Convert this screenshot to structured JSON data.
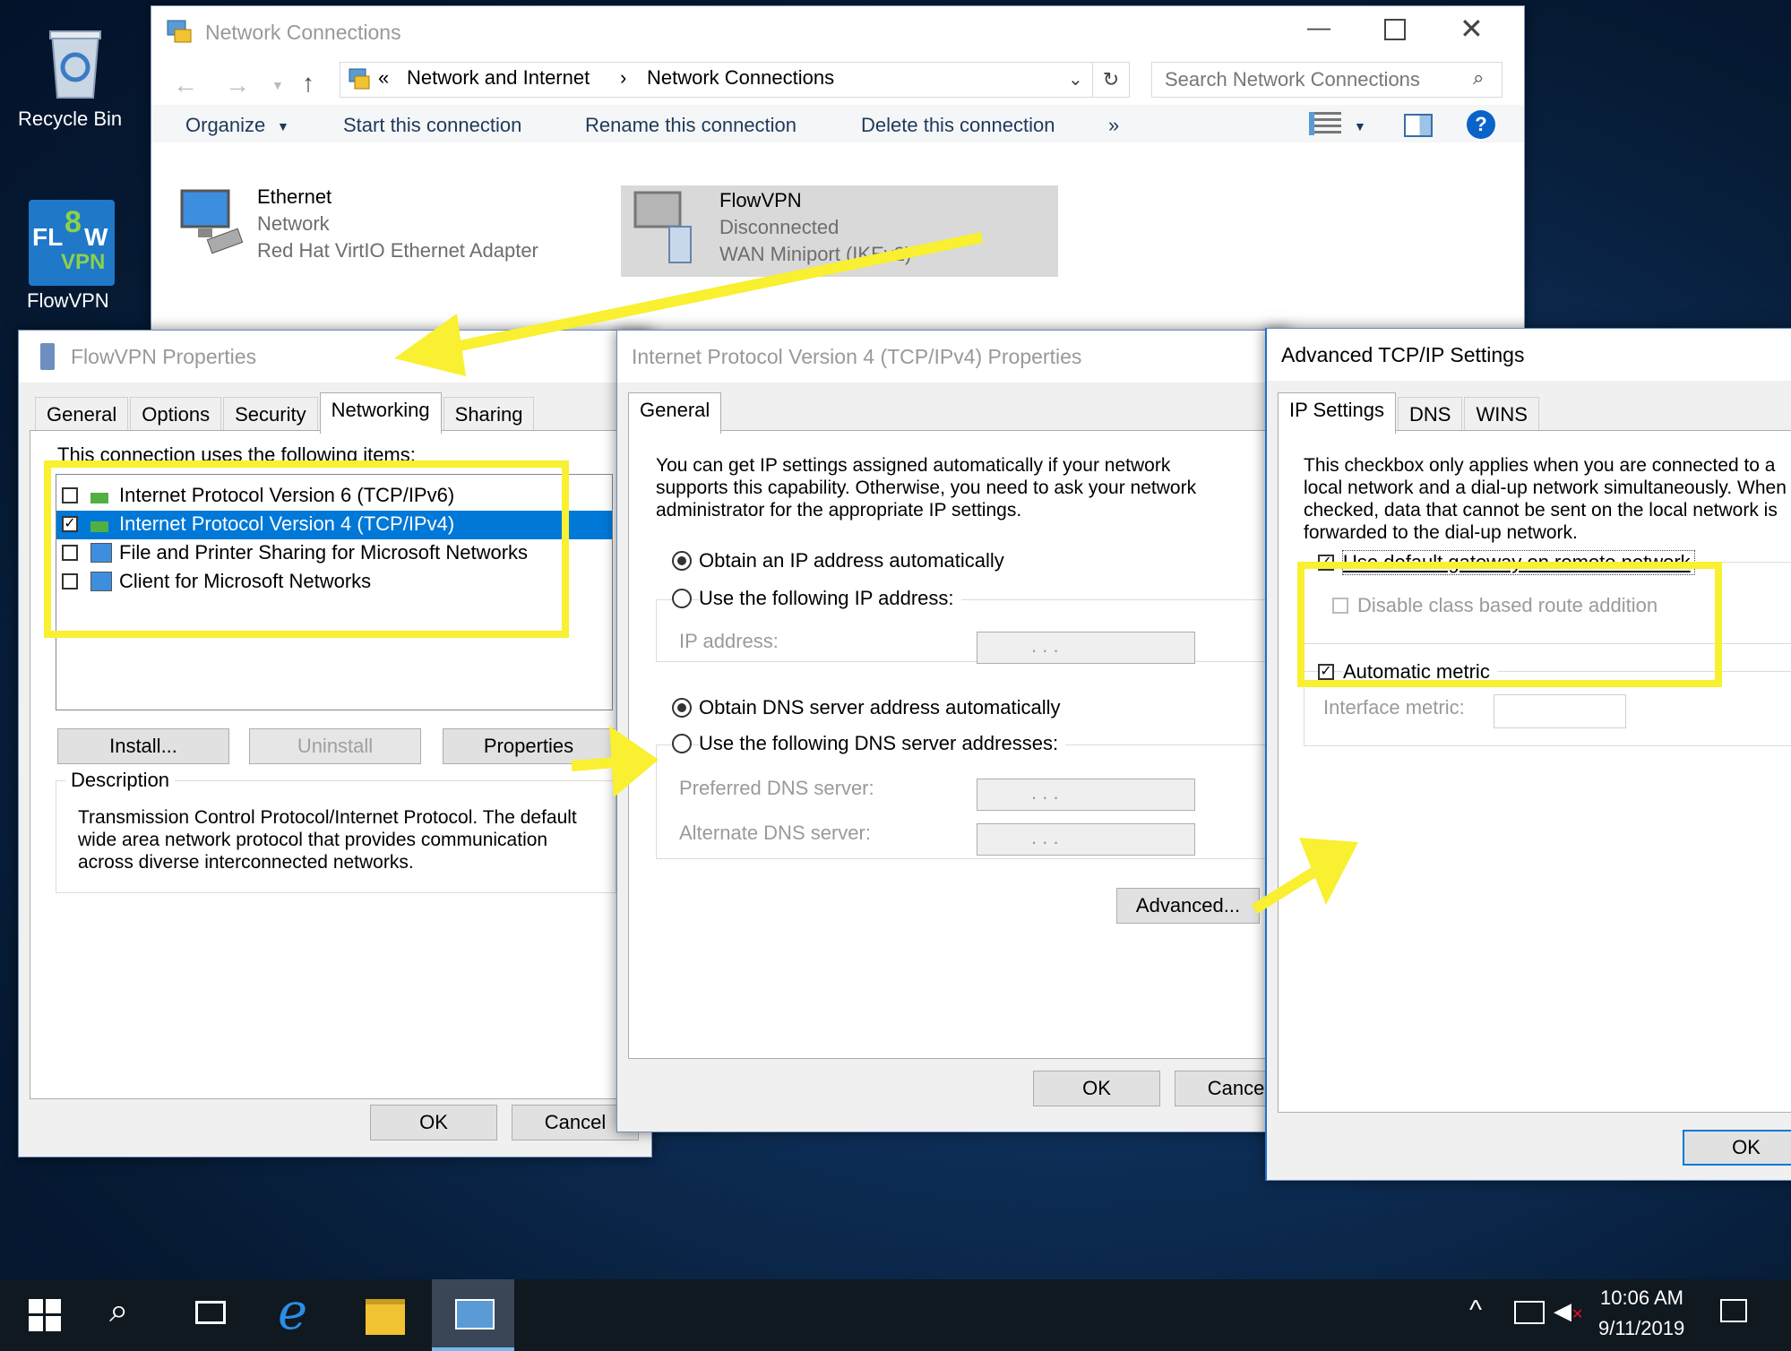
{
  "desktop": {
    "icons": [
      {
        "label": "Recycle Bin"
      },
      {
        "label": "FlowVPN",
        "logo_text_top": "FL",
        "logo_text_o": "8",
        "logo_text_w": "W",
        "logo_text_vpn": "VPN"
      }
    ]
  },
  "network_window": {
    "title": "Network Connections",
    "breadcrumb": {
      "prefix": "«",
      "items": [
        "Network and Internet",
        "Network Connections"
      ],
      "separator": "›"
    },
    "search_placeholder": "Search Network Connections",
    "toolbar": {
      "organize": "Organize",
      "start": "Start this connection",
      "rename": "Rename this connection",
      "delete": "Delete this connection",
      "more": "»"
    },
    "connections": [
      {
        "name": "Ethernet",
        "status": "Network",
        "adapter": "Red Hat VirtIO Ethernet Adapter"
      },
      {
        "name": "FlowVPN",
        "status": "Disconnected",
        "adapter": "WAN Miniport (IKEv2)"
      }
    ]
  },
  "flowvpn_props": {
    "title": "FlowVPN Properties",
    "tabs": [
      "General",
      "Options",
      "Security",
      "Networking",
      "Sharing"
    ],
    "active_tab": "Networking",
    "items_header": "This connection uses the following items:",
    "items": [
      {
        "label": "Internet Protocol Version 6 (TCP/IPv6)",
        "checked": "false"
      },
      {
        "label": "Internet Protocol Version 4 (TCP/IPv4)",
        "checked": "true"
      },
      {
        "label": "File and Printer Sharing for Microsoft Networks",
        "checked": "false"
      },
      {
        "label": "Client for Microsoft Networks",
        "checked": "false"
      }
    ],
    "buttons": {
      "install": "Install...",
      "uninstall": "Uninstall",
      "properties": "Properties",
      "ok": "OK",
      "cancel": "Cancel"
    },
    "description_label": "Description",
    "description": "Transmission Control Protocol/Internet Protocol. The default wide area network protocol that provides communication across diverse interconnected networks."
  },
  "ipv4_props": {
    "title": "Internet Protocol Version 4 (TCP/IPv4) Properties",
    "tab": "General",
    "intro": "You can get IP settings assigned automatically if your network supports this capability. Otherwise, you need to ask your network administrator for the appropriate IP settings.",
    "obtain_ip_auto": "Obtain an IP address automatically",
    "use_following_ip": "Use the following IP address:",
    "ip_address_label": "IP address:",
    "obtain_dns_auto": "Obtain DNS server address automatically",
    "use_following_dns": "Use the following DNS server addresses:",
    "preferred_dns": "Preferred DNS server:",
    "alternate_dns": "Alternate DNS server:",
    "ip_dots": ".   .   .",
    "advanced": "Advanced...",
    "ok": "OK",
    "cancel": "Cancel"
  },
  "advanced_tcpip": {
    "title": "Advanced TCP/IP Settings",
    "tabs": [
      "IP Settings",
      "DNS",
      "WINS"
    ],
    "intro": "This checkbox only applies when you are connected to a local network and a dial-up network simultaneously.  When checked, data that cannot be sent on the local network is forwarded to the dial-up network.",
    "use_default_gateway": "Use default gateway on remote network",
    "disable_class_route": "Disable class based route addition",
    "automatic_metric": "Automatic metric",
    "interface_metric": "Interface metric:",
    "ok": "OK"
  },
  "taskbar": {
    "time": "10:06 AM",
    "date": "9/11/2019"
  },
  "colors": {
    "highlight": "#f8f030",
    "selection": "#0078d7",
    "help": "#0a63c9"
  }
}
